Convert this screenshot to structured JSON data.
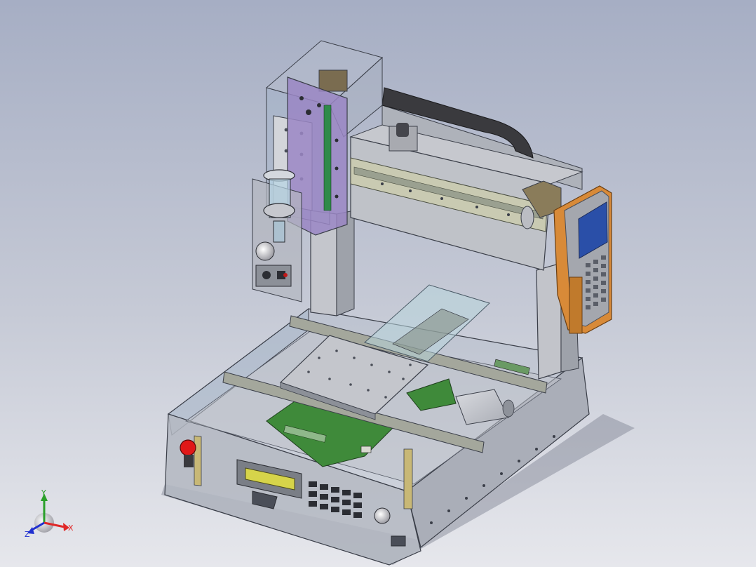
{
  "viewport": {
    "background_top": "#a6aec4",
    "background_mid": "#c6cad6",
    "background_bottom": "#e6e7ec"
  },
  "triad": {
    "x_label": "X",
    "y_label": "Y",
    "z_label": "Z",
    "x_color": "#e02828",
    "y_color": "#2aa02a",
    "z_color": "#2030d0"
  },
  "model": {
    "frame_color": "#b9bcc4",
    "glass_color": "#9fb3c8",
    "linear_rail_color": "#c9cab2",
    "pcb_color": "#3f8a3a",
    "z_head_plate_color": "#9a86c4",
    "teach_pendant_housing_color": "#d88a38",
    "teach_pendant_screen_color": "#2a4fa8",
    "lcd_color": "#d6d44a",
    "emergency_stop_color": "#e01818",
    "cable_chain_color": "#3a3a3e"
  },
  "icons": {
    "triad": "coordinate-triad-icon",
    "estop": "emergency-stop-icon"
  }
}
